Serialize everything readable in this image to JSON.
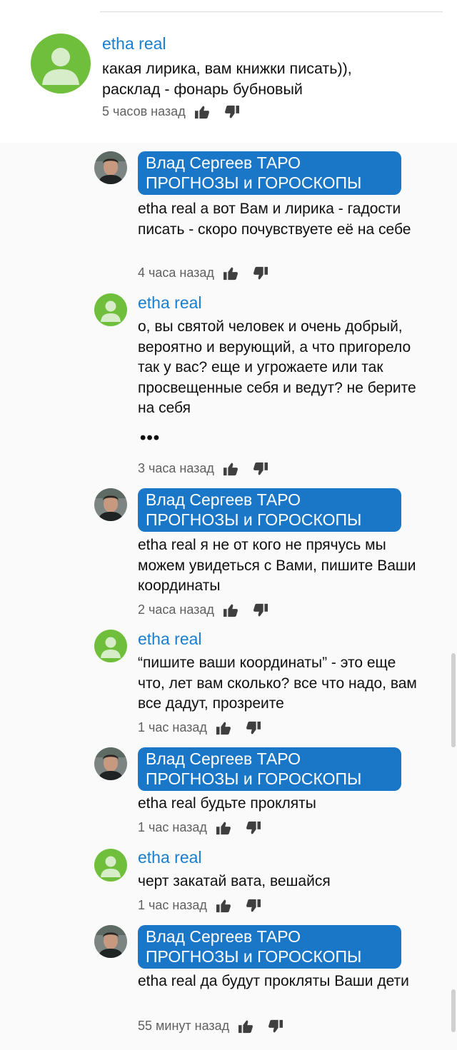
{
  "comments": [
    {
      "author": "etha real",
      "text": "какая лирика, вам книжки писать)), расклад - фонарь бубновый",
      "time": "5 часов назад",
      "avatar": "default-user-avatar",
      "like_icon": "thumbs-up-icon",
      "dislike_icon": "thumbs-down-icon"
    }
  ],
  "replies": [
    {
      "author": "Влад Сергеев ТАРО ПРОГНОЗЫ и ГОРОСКОПЫ",
      "text": "etha real а вот Вам и лирика - гадости писать - скоро почувствуете её на себе",
      "time": "4 часа назад",
      "avatar": "channel-owner-photo"
    },
    {
      "author": "etha real",
      "text": "о, вы святой человек и очень добрый, вероятно и верующий, а что пригорело так у вас? еще и угрожаете или так просвещенные себя и ведут? не берите на себя",
      "more": "•••",
      "time": "3 часа назад",
      "avatar": "default-user-avatar"
    },
    {
      "author": "Влад Сергеев ТАРО ПРОГНОЗЫ и ГОРОСКОПЫ",
      "text": "etha real я не от кого не прячусь мы можем увидеться с Вами, пишите Ваши координаты",
      "time": "2 часа назад",
      "avatar": "channel-owner-photo"
    },
    {
      "author": "etha real",
      "text": "“пишите ваши координаты” - это еще что, лет вам сколько? все что надо, вам все дадут, прозреите",
      "time": "1 час назад",
      "avatar": "default-user-avatar"
    },
    {
      "author": "Влад Сергеев ТАРО ПРОГНОЗЫ и ГОРОСКОПЫ",
      "text": "etha real будьте прокляты",
      "time": "1 час назад",
      "avatar": "channel-owner-photo"
    },
    {
      "author": "etha real",
      "text": "черт закатай вата, вешайся",
      "time": "1 час назад",
      "avatar": "default-user-avatar"
    },
    {
      "author": "Влад Сергеев ТАРО ПРОГНОЗЫ и ГОРОСКОПЫ",
      "text": "etha real да будут прокляты Ваши дети",
      "time": "55 минут назад",
      "avatar": "channel-owner-photo"
    }
  ],
  "colors": {
    "author_link": "#1a7ecf",
    "owner_badge": "#1a76c7",
    "default_avatar": "#6fbf3c",
    "meta_text": "#606060"
  }
}
